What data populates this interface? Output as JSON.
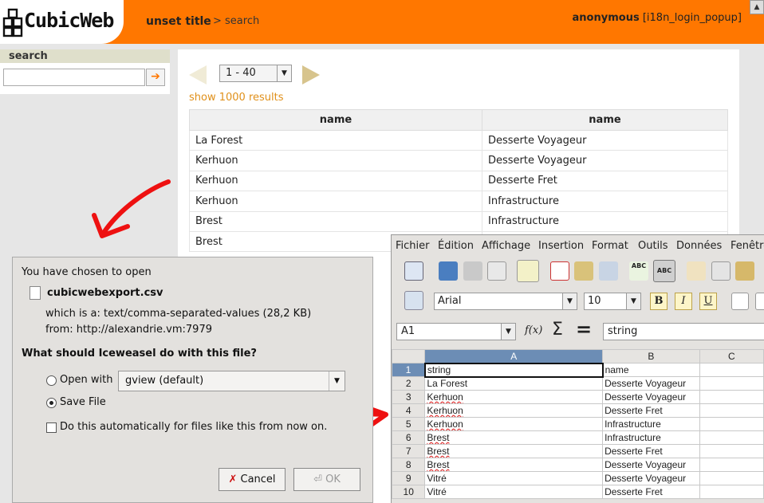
{
  "header": {
    "logo_text": "CubicWeb",
    "page_title": "unset title",
    "breadcrumb": "> search",
    "user_name": "anonymous",
    "login_link": "[i18n_login_popup]",
    "scroll_glyph": "▲"
  },
  "sidebar": {
    "search_title": "search",
    "search_value": "",
    "search_button": "➔"
  },
  "results": {
    "pager_range": "1 - 40",
    "show_more": "show 1000 results",
    "columns": [
      "name",
      "name"
    ],
    "rows": [
      [
        "La Forest",
        "Desserte Voyageur"
      ],
      [
        "Kerhuon",
        "Desserte Voyageur"
      ],
      [
        "Kerhuon",
        "Desserte Fret"
      ],
      [
        "Kerhuon",
        "Infrastructure"
      ],
      [
        "Brest",
        "Infrastructure"
      ],
      [
        "Brest",
        ""
      ]
    ]
  },
  "dialog": {
    "intro": "You have chosen to open",
    "file_name": "cubicwebexport.csv",
    "file_type": "which is a:  text/comma-separated-values (28,2  KB)",
    "file_from": "from:  http://alexandrie.vm:7979",
    "question": "What should Iceweasel do with this file?",
    "open_with_label": "Open with",
    "open_with_app": "gview (default)",
    "save_label": "Save File",
    "auto_label": "Do this automatically for files like this from now on.",
    "cancel_label": "Cancel",
    "ok_label": "OK",
    "selected_action": "save"
  },
  "spreadsheet": {
    "menu": [
      "Fichier",
      "Édition",
      "Affichage",
      "Insertion",
      "Format",
      "Outils",
      "Données",
      "Fenêtre"
    ],
    "font_name": "Arial",
    "font_size": "10",
    "bold_label": "B",
    "italic_label": "I",
    "underline_label": "U",
    "cell_ref": "A1",
    "formula_value": "string",
    "sigma_glyph": "Σ",
    "equals_glyph": "=",
    "columns": [
      "A",
      "B",
      "C"
    ],
    "rows": [
      {
        "n": "1",
        "a": "string",
        "b": "name"
      },
      {
        "n": "2",
        "a": "La Forest",
        "b": "Desserte Voyageur"
      },
      {
        "n": "3",
        "a": "Kerhuon",
        "b": "Desserte Voyageur"
      },
      {
        "n": "4",
        "a": "Kerhuon",
        "b": "Desserte Fret"
      },
      {
        "n": "5",
        "a": "Kerhuon",
        "b": "Infrastructure"
      },
      {
        "n": "6",
        "a": "Brest",
        "b": "Infrastructure"
      },
      {
        "n": "7",
        "a": "Brest",
        "b": "Desserte Fret"
      },
      {
        "n": "8",
        "a": "Brest",
        "b": "Desserte Voyageur"
      },
      {
        "n": "9",
        "a": "Vitré",
        "b": "Desserte Voyageur"
      },
      {
        "n": "10",
        "a": "Vitré",
        "b": "Desserte Fret"
      }
    ]
  },
  "colors": {
    "brand_orange": "#ff7700",
    "annotation_red": "#ee1111",
    "selection_blue": "#6c8db5"
  }
}
